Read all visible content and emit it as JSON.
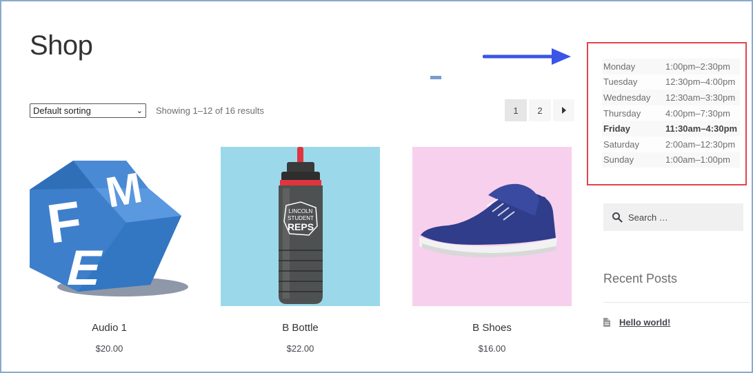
{
  "page": {
    "title": "Shop"
  },
  "toolbar": {
    "sort_selected": "Default sorting",
    "result_count": "Showing 1–12 of 16 results"
  },
  "pagination": {
    "pages": [
      "1",
      "2"
    ],
    "current": "1",
    "next_icon": "chevron-right-icon"
  },
  "products": [
    {
      "name": "Audio 1",
      "price": "$20.00",
      "image": "fme-logo-cube",
      "bg": "#ffffff"
    },
    {
      "name": "B Bottle",
      "price": "$22.00",
      "image": "water-bottle",
      "bg": "#9bd9ea",
      "bottle_text_1": "LINCOLN",
      "bottle_text_2": "STUDENT",
      "bottle_text_3": "REPS"
    },
    {
      "name": "B Shoes",
      "price": "$16.00",
      "image": "sneaker",
      "bg": "#f7d0ed"
    }
  ],
  "hours": [
    {
      "day": "Monday",
      "time": "1:00pm–2:30pm"
    },
    {
      "day": "Tuesday",
      "time": "12:30pm–4:00pm"
    },
    {
      "day": "Wednesday",
      "time": "12:30am–3:30pm"
    },
    {
      "day": "Thursday",
      "time": "4:00pm–7:30pm"
    },
    {
      "day": "Friday",
      "time": "11:30am–4:30pm",
      "today": true
    },
    {
      "day": "Saturday",
      "time": "2:00am–12:30pm"
    },
    {
      "day": "Sunday",
      "time": "1:00am–1:00pm"
    }
  ],
  "sidebar": {
    "search_placeholder": "Search …",
    "recent_posts_title": "Recent Posts",
    "recent_posts": [
      "Hello world!"
    ]
  },
  "colors": {
    "annotation_arrow": "#3b55e6",
    "annotation_box": "#e0434a",
    "frame": "#8aa8cc"
  }
}
